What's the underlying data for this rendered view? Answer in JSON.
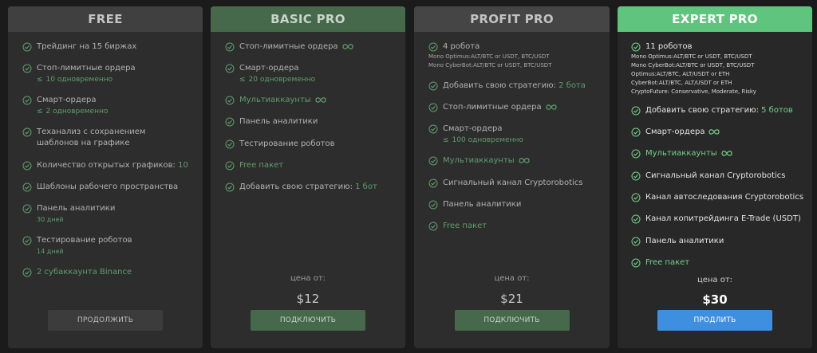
{
  "plans": [
    {
      "title": "FREE",
      "features": [
        {
          "text": "Трейдинг на 15 биржах"
        },
        {
          "text": "Стоп-лимитные ордера",
          "limit": "10 одновременно"
        },
        {
          "text": "Смарт-ордера",
          "limit": "2 одновременно"
        },
        {
          "text": "Теханализ с сохранением шаблонов на графике"
        },
        {
          "text": "Количество открытых графиков:",
          "value": "10"
        },
        {
          "text": "Шаблоны рабочего пространства"
        },
        {
          "text": "Панель аналитики",
          "note": "30 дней"
        },
        {
          "text": "Тестирование роботов",
          "note": "14 дней"
        },
        {
          "text": "2 субаккаунта Binance"
        }
      ],
      "button": "ПРОДОЛЖИТЬ"
    },
    {
      "title": "BASIC PRO",
      "features": [
        {
          "text": "Стоп-лимитные ордера",
          "infinity": true
        },
        {
          "text": "Смарт-ордера",
          "limit": "20 одновременно"
        },
        {
          "text": "Мультиаккаунты",
          "infinity": true
        },
        {
          "text": "Панель аналитики"
        },
        {
          "text": "Тестирование роботов"
        },
        {
          "text": "Free пакет"
        },
        {
          "text": "Добавить свою стратегию:",
          "value": "1 бот"
        }
      ],
      "price_label": "цена от:",
      "price": "$12",
      "button": "ПОДКЛЮЧИТЬ"
    },
    {
      "title": "PROFIT PRO",
      "features": [
        {
          "text": "4 робота",
          "details": [
            "Mono Optimus:ALT/BTC or USDT, BTC/USDT",
            "Mono CyberBot:ALT/BTC or USDT, BTC/USDT"
          ]
        },
        {
          "text": "Добавить свою стратегию:",
          "value": "2 бота"
        },
        {
          "text": "Стоп-лимитные ордера",
          "infinity": true
        },
        {
          "text": "Смарт-ордера",
          "limit": "100 одновременно"
        },
        {
          "text": "Мультиаккаунты",
          "infinity": true
        },
        {
          "text": "Сигнальный канал Cryptorobotics"
        },
        {
          "text": "Панель аналитики"
        },
        {
          "text": "Free пакет"
        }
      ],
      "price_label": "цена от:",
      "price": "$21",
      "button": "ПОДКЛЮЧИТЬ"
    },
    {
      "title": "EXPERT PRO",
      "features": [
        {
          "text": "11 роботов",
          "details": [
            "Mono Optimus:ALT/BTC or USDT, BTC/USDT",
            "Mono CyberBot:ALT/BTC or USDT, BTC/USDT",
            "Optimus:ALT/BTC, ALT/USDT or ETH",
            "CyberBot:ALT/BTC, ALT/USDT or ETH",
            "CryptoFuture: Conservative, Moderate, Risky"
          ]
        },
        {
          "text": "Добавить свою стратегию:",
          "value": "5 ботов"
        },
        {
          "text": "Смарт-ордера",
          "infinity": true
        },
        {
          "text": "Мультиаккаунты",
          "infinity": true
        },
        {
          "text": "Сигнальный канал Cryptorobotics"
        },
        {
          "text": "Канал автоследования Cryptorobotics"
        },
        {
          "text": "Канал копитрейдинга E-Trade (USDT)"
        },
        {
          "text": "Панель аналитики"
        },
        {
          "text": "Free пакет"
        }
      ],
      "price_label": "цена от:",
      "price": "$30",
      "button": "ПРОДЛИТЬ"
    }
  ],
  "colors": {
    "background": "#1b1b1b",
    "card": "#2d2d2d",
    "accent_green": "#5e9e6c",
    "expert_header": "#5fc47e",
    "expert_button": "#3f8fe0",
    "basic_green": "#45694a"
  },
  "icons": {
    "check": "check-circle-icon",
    "infinity": "infinity-icon",
    "limit": "less-equal-icon"
  }
}
